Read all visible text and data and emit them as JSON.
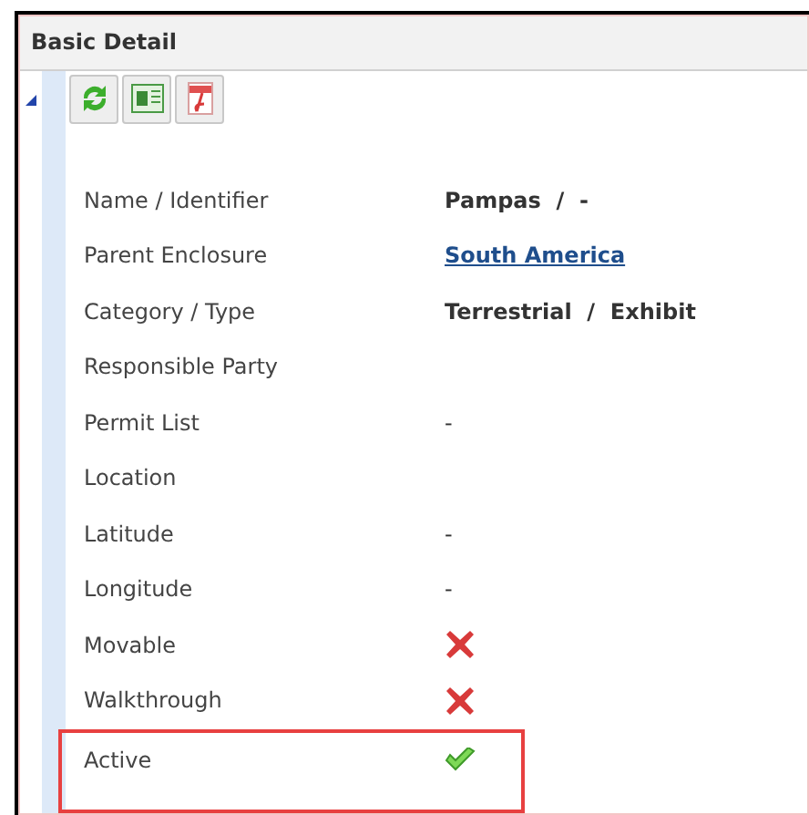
{
  "panel": {
    "title": "Basic Detail",
    "expanded": true
  },
  "rows": [
    {
      "label": "Name / Identifier",
      "kind": "text",
      "value": "Pampas  /  -",
      "highlighted": false
    },
    {
      "label": "Parent Enclosure",
      "kind": "link",
      "value": "South America",
      "highlighted": false
    },
    {
      "label": "Category / Type",
      "kind": "text",
      "value": "Terrestrial  /  Exhibit",
      "highlighted": false
    },
    {
      "label": "Responsible Party",
      "kind": "empty",
      "highlighted": false
    },
    {
      "label": "Permit List",
      "kind": "plain",
      "value": "-",
      "highlighted": false
    },
    {
      "label": "Location",
      "kind": "empty",
      "highlighted": false
    },
    {
      "label": "Latitude",
      "kind": "plain",
      "value": "-",
      "highlighted": false
    },
    {
      "label": "Longitude",
      "kind": "plain",
      "value": "-",
      "highlighted": false
    },
    {
      "label": "Movable",
      "kind": "boolean",
      "checked": false,
      "highlighted": false
    },
    {
      "label": "Walkthrough",
      "kind": "boolean",
      "checked": false,
      "highlighted": false
    },
    {
      "label": "Active",
      "kind": "boolean",
      "checked": true,
      "highlighted": true
    }
  ]
}
